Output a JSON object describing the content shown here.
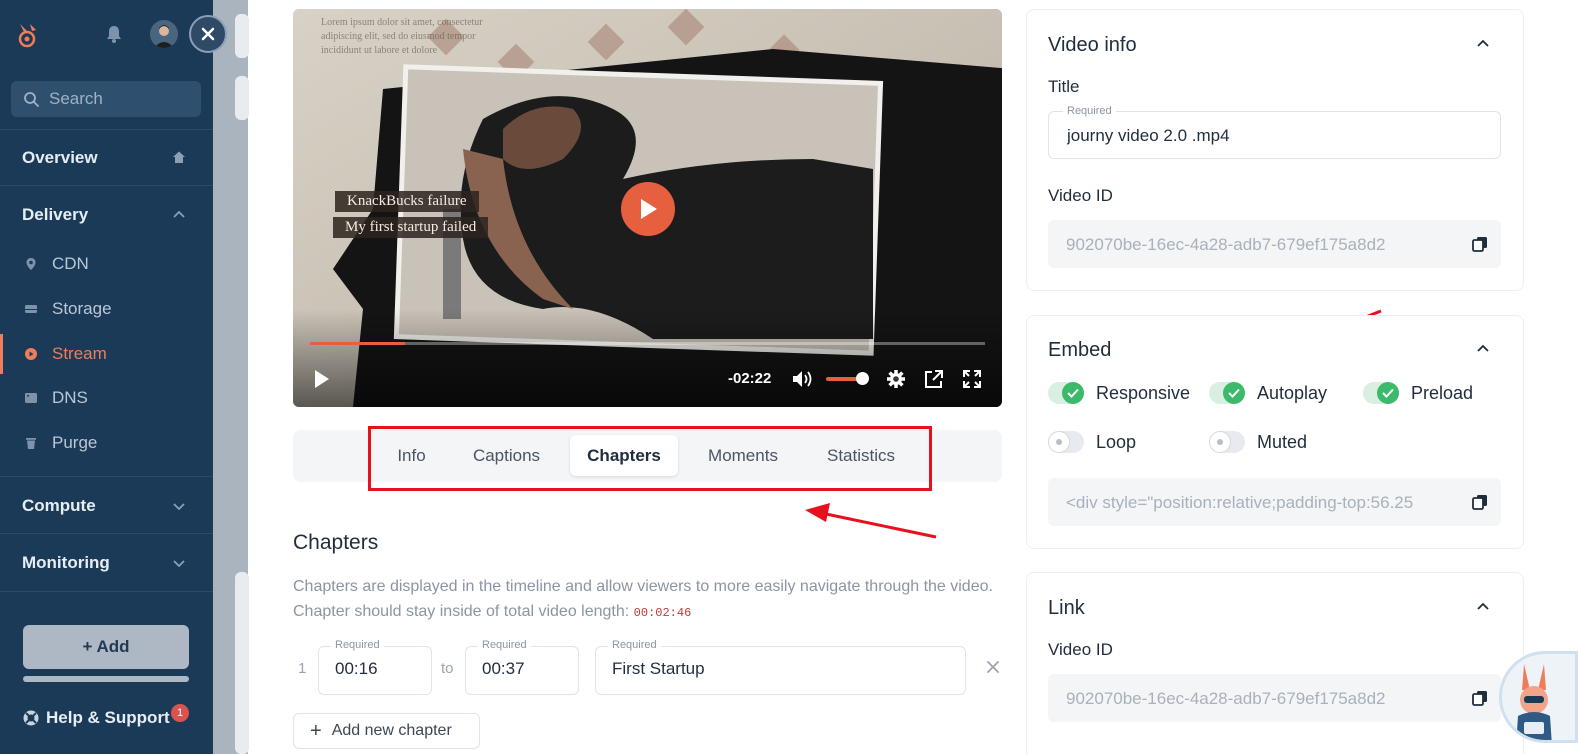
{
  "sidebar": {
    "search_placeholder": "Search",
    "overview_label": "Overview",
    "delivery_label": "Delivery",
    "items": [
      {
        "label": "CDN"
      },
      {
        "label": "Storage"
      },
      {
        "label": "Stream"
      },
      {
        "label": "DNS"
      },
      {
        "label": "Purge"
      }
    ],
    "compute_label": "Compute",
    "monitoring_label": "Monitoring",
    "add_label": "+ Add",
    "help_label": "Help & Support",
    "help_badge": "1",
    "active_item": "Stream",
    "accent_color": "#f07d5a"
  },
  "player": {
    "overlay_text_1": "KnackBucks failure",
    "overlay_text_2": "My first startup failed",
    "time_remaining": "-02:22",
    "progress_fraction": 0.14,
    "volume_fraction": 0.85
  },
  "tabs": {
    "items": [
      "Info",
      "Captions",
      "Chapters",
      "Moments",
      "Statistics"
    ],
    "active": "Chapters"
  },
  "chapters": {
    "title": "Chapters",
    "description": "Chapters are displayed in the timeline and allow viewers to more easily navigate through the video. Chapter should stay inside of total video length:",
    "total_length": "00:02:46",
    "rows": [
      {
        "index": "1",
        "start_label": "Required",
        "start": "00:16",
        "to": "to",
        "end_label": "Required",
        "end": "00:37",
        "title_label": "Required",
        "title": "First Startup"
      }
    ],
    "add_label": "Add new chapter"
  },
  "video_info": {
    "title": "Video info",
    "title_field_label": "Title",
    "title_field_hint": "Required",
    "title_value": "journy video 2.0 .mp4",
    "video_id_label": "Video ID",
    "video_id_value": "902070be-16ec-4a28-adb7-679ef175a8d2"
  },
  "embed": {
    "title": "Embed",
    "toggles": [
      {
        "label": "Responsive",
        "on": true
      },
      {
        "label": "Autoplay",
        "on": true
      },
      {
        "label": "Preload",
        "on": true
      },
      {
        "label": "Loop",
        "on": false
      },
      {
        "label": "Muted",
        "on": false
      }
    ],
    "code": "<div style=\"position:relative;padding-top:56.25"
  },
  "link": {
    "title": "Link",
    "video_id_label": "Video ID",
    "video_id_value": "902070be-16ec-4a28-adb7-679ef175a8d2"
  },
  "colors": {
    "sidebar_bg": "#1b3a57",
    "accent": "#e65f3f",
    "toggle_on": "#3cba6b",
    "annotation_red": "#e8101c"
  }
}
